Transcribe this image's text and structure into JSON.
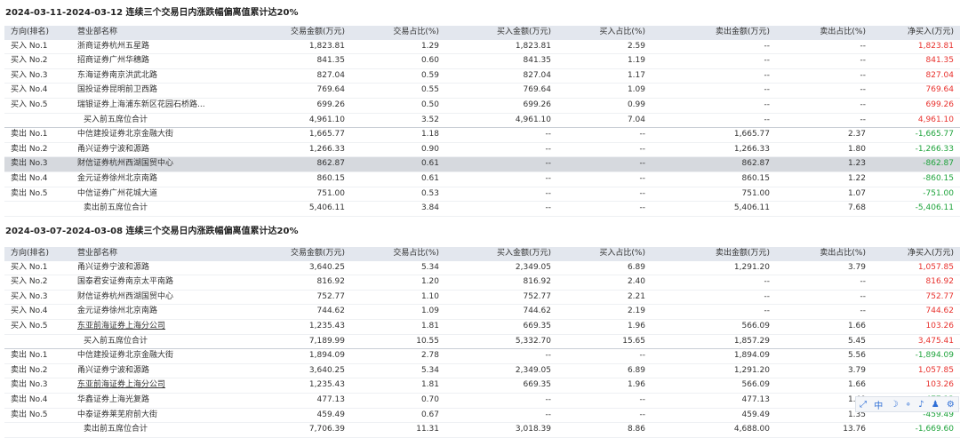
{
  "headers": [
    "方向(排名)",
    "营业部名称",
    "交易金额(万元)",
    "交易占比(%)",
    "买入金额(万元)",
    "买入占比(%)",
    "卖出金额(万元)",
    "卖出占比(%)",
    "净买入(万元)"
  ],
  "sections": [
    {
      "title": "2024-03-11-2024-03-12 连续三个交易日内涨跌幅偏离值累计达20%",
      "rows": [
        {
          "dir": "买入 No.1",
          "name": "浙商证券杭州五星路",
          "amt": "1,823.81",
          "pct": "1.29",
          "buy": "1,823.81",
          "buy_pct": "2.59",
          "sell": "--",
          "sell_pct": "--",
          "net": "1,823.81",
          "net_color": "red"
        },
        {
          "dir": "买入 No.2",
          "name": "招商证券广州华穗路",
          "amt": "841.35",
          "pct": "0.60",
          "buy": "841.35",
          "buy_pct": "1.19",
          "sell": "--",
          "sell_pct": "--",
          "net": "841.35",
          "net_color": "red"
        },
        {
          "dir": "买入 No.3",
          "name": "东海证券南京洪武北路",
          "amt": "827.04",
          "pct": "0.59",
          "buy": "827.04",
          "buy_pct": "1.17",
          "sell": "--",
          "sell_pct": "--",
          "net": "827.04",
          "net_color": "red"
        },
        {
          "dir": "买入 No.4",
          "name": "国投证券昆明前卫西路",
          "amt": "769.64",
          "pct": "0.55",
          "buy": "769.64",
          "buy_pct": "1.09",
          "sell": "--",
          "sell_pct": "--",
          "net": "769.64",
          "net_color": "red"
        },
        {
          "dir": "买入 No.5",
          "name": "瑞银证券上海浦东新区花园石桥路...",
          "amt": "699.26",
          "pct": "0.50",
          "buy": "699.26",
          "buy_pct": "0.99",
          "sell": "--",
          "sell_pct": "--",
          "net": "699.26",
          "net_color": "red"
        },
        {
          "dir": "",
          "name": "买入前五席位合计",
          "amt": "4,961.10",
          "pct": "3.52",
          "buy": "4,961.10",
          "buy_pct": "7.04",
          "sell": "--",
          "sell_pct": "--",
          "net": "4,961.10",
          "net_color": "red",
          "total": true,
          "sep": true
        },
        {
          "dir": "卖出 No.1",
          "name": "中信建投证券北京金融大街",
          "amt": "1,665.77",
          "pct": "1.18",
          "buy": "--",
          "buy_pct": "--",
          "sell": "1,665.77",
          "sell_pct": "2.37",
          "net": "-1,665.77",
          "net_color": "green"
        },
        {
          "dir": "卖出 No.2",
          "name": "甬兴证券宁波和源路",
          "amt": "1,266.33",
          "pct": "0.90",
          "buy": "--",
          "buy_pct": "--",
          "sell": "1,266.33",
          "sell_pct": "1.80",
          "net": "-1,266.33",
          "net_color": "green"
        },
        {
          "dir": "卖出 No.3",
          "name": "财信证券杭州西湖国贸中心",
          "amt": "862.87",
          "pct": "0.61",
          "buy": "--",
          "buy_pct": "--",
          "sell": "862.87",
          "sell_pct": "1.23",
          "net": "-862.87",
          "net_color": "green",
          "highlight": true
        },
        {
          "dir": "卖出 No.4",
          "name": "金元证券徐州北京南路",
          "amt": "860.15",
          "pct": "0.61",
          "buy": "--",
          "buy_pct": "--",
          "sell": "860.15",
          "sell_pct": "1.22",
          "net": "-860.15",
          "net_color": "green"
        },
        {
          "dir": "卖出 No.5",
          "name": "中信证券广州花城大道",
          "amt": "751.00",
          "pct": "0.53",
          "buy": "--",
          "buy_pct": "--",
          "sell": "751.00",
          "sell_pct": "1.07",
          "net": "-751.00",
          "net_color": "green"
        },
        {
          "dir": "",
          "name": "卖出前五席位合计",
          "amt": "5,406.11",
          "pct": "3.84",
          "buy": "--",
          "buy_pct": "--",
          "sell": "5,406.11",
          "sell_pct": "7.68",
          "net": "-5,406.11",
          "net_color": "green",
          "total": true
        }
      ]
    },
    {
      "title": "2024-03-07-2024-03-08 连续三个交易日内涨跌幅偏离值累计达20%",
      "rows": [
        {
          "dir": "买入 No.1",
          "name": "甬兴证券宁波和源路",
          "amt": "3,640.25",
          "pct": "5.34",
          "buy": "2,349.05",
          "buy_pct": "6.89",
          "sell": "1,291.20",
          "sell_pct": "3.79",
          "net": "1,057.85",
          "net_color": "red"
        },
        {
          "dir": "买入 No.2",
          "name": "国泰君安证券南京太平南路",
          "amt": "816.92",
          "pct": "1.20",
          "buy": "816.92",
          "buy_pct": "2.40",
          "sell": "--",
          "sell_pct": "--",
          "net": "816.92",
          "net_color": "red"
        },
        {
          "dir": "买入 No.3",
          "name": "财信证券杭州西湖国贸中心",
          "amt": "752.77",
          "pct": "1.10",
          "buy": "752.77",
          "buy_pct": "2.21",
          "sell": "--",
          "sell_pct": "--",
          "net": "752.77",
          "net_color": "red"
        },
        {
          "dir": "买入 No.4",
          "name": "金元证券徐州北京南路",
          "amt": "744.62",
          "pct": "1.09",
          "buy": "744.62",
          "buy_pct": "2.19",
          "sell": "--",
          "sell_pct": "--",
          "net": "744.62",
          "net_color": "red"
        },
        {
          "dir": "买入 No.5",
          "name": "东亚前海证券上海分公司",
          "amt": "1,235.43",
          "pct": "1.81",
          "buy": "669.35",
          "buy_pct": "1.96",
          "sell": "566.09",
          "sell_pct": "1.66",
          "net": "103.26",
          "net_color": "red",
          "link": true
        },
        {
          "dir": "",
          "name": "买入前五席位合计",
          "amt": "7,189.99",
          "pct": "10.55",
          "buy": "5,332.70",
          "buy_pct": "15.65",
          "sell": "1,857.29",
          "sell_pct": "5.45",
          "net": "3,475.41",
          "net_color": "red",
          "total": true,
          "sep": true
        },
        {
          "dir": "卖出 No.1",
          "name": "中信建投证券北京金融大街",
          "amt": "1,894.09",
          "pct": "2.78",
          "buy": "--",
          "buy_pct": "--",
          "sell": "1,894.09",
          "sell_pct": "5.56",
          "net": "-1,894.09",
          "net_color": "green"
        },
        {
          "dir": "卖出 No.2",
          "name": "甬兴证券宁波和源路",
          "amt": "3,640.25",
          "pct": "5.34",
          "buy": "2,349.05",
          "buy_pct": "6.89",
          "sell": "1,291.20",
          "sell_pct": "3.79",
          "net": "1,057.85",
          "net_color": "red"
        },
        {
          "dir": "卖出 No.3",
          "name": "东亚前海证券上海分公司",
          "amt": "1,235.43",
          "pct": "1.81",
          "buy": "669.35",
          "buy_pct": "1.96",
          "sell": "566.09",
          "sell_pct": "1.66",
          "net": "103.26",
          "net_color": "red",
          "link": true
        },
        {
          "dir": "卖出 No.4",
          "name": "华鑫证券上海光复路",
          "amt": "477.13",
          "pct": "0.70",
          "buy": "--",
          "buy_pct": "--",
          "sell": "477.13",
          "sell_pct": "1.40",
          "net": "-477.13",
          "net_color": "green"
        },
        {
          "dir": "卖出 No.5",
          "name": "中泰证券莱芜府前大街",
          "amt": "459.49",
          "pct": "0.67",
          "buy": "--",
          "buy_pct": "--",
          "sell": "459.49",
          "sell_pct": "1.35",
          "net": "-459.49",
          "net_color": "green"
        },
        {
          "dir": "",
          "name": "卖出前五席位合计",
          "amt": "7,706.39",
          "pct": "11.31",
          "buy": "3,018.39",
          "buy_pct": "8.86",
          "sell": "4,688.00",
          "sell_pct": "13.76",
          "net": "-1,669.60",
          "net_color": "green",
          "total": true
        }
      ]
    }
  ],
  "widget": {
    "expand": "⤢",
    "lang": "中",
    "moon": "☽",
    "dots": "∘",
    "mic": "♪",
    "shirt": "♟",
    "gear": "⚙"
  }
}
